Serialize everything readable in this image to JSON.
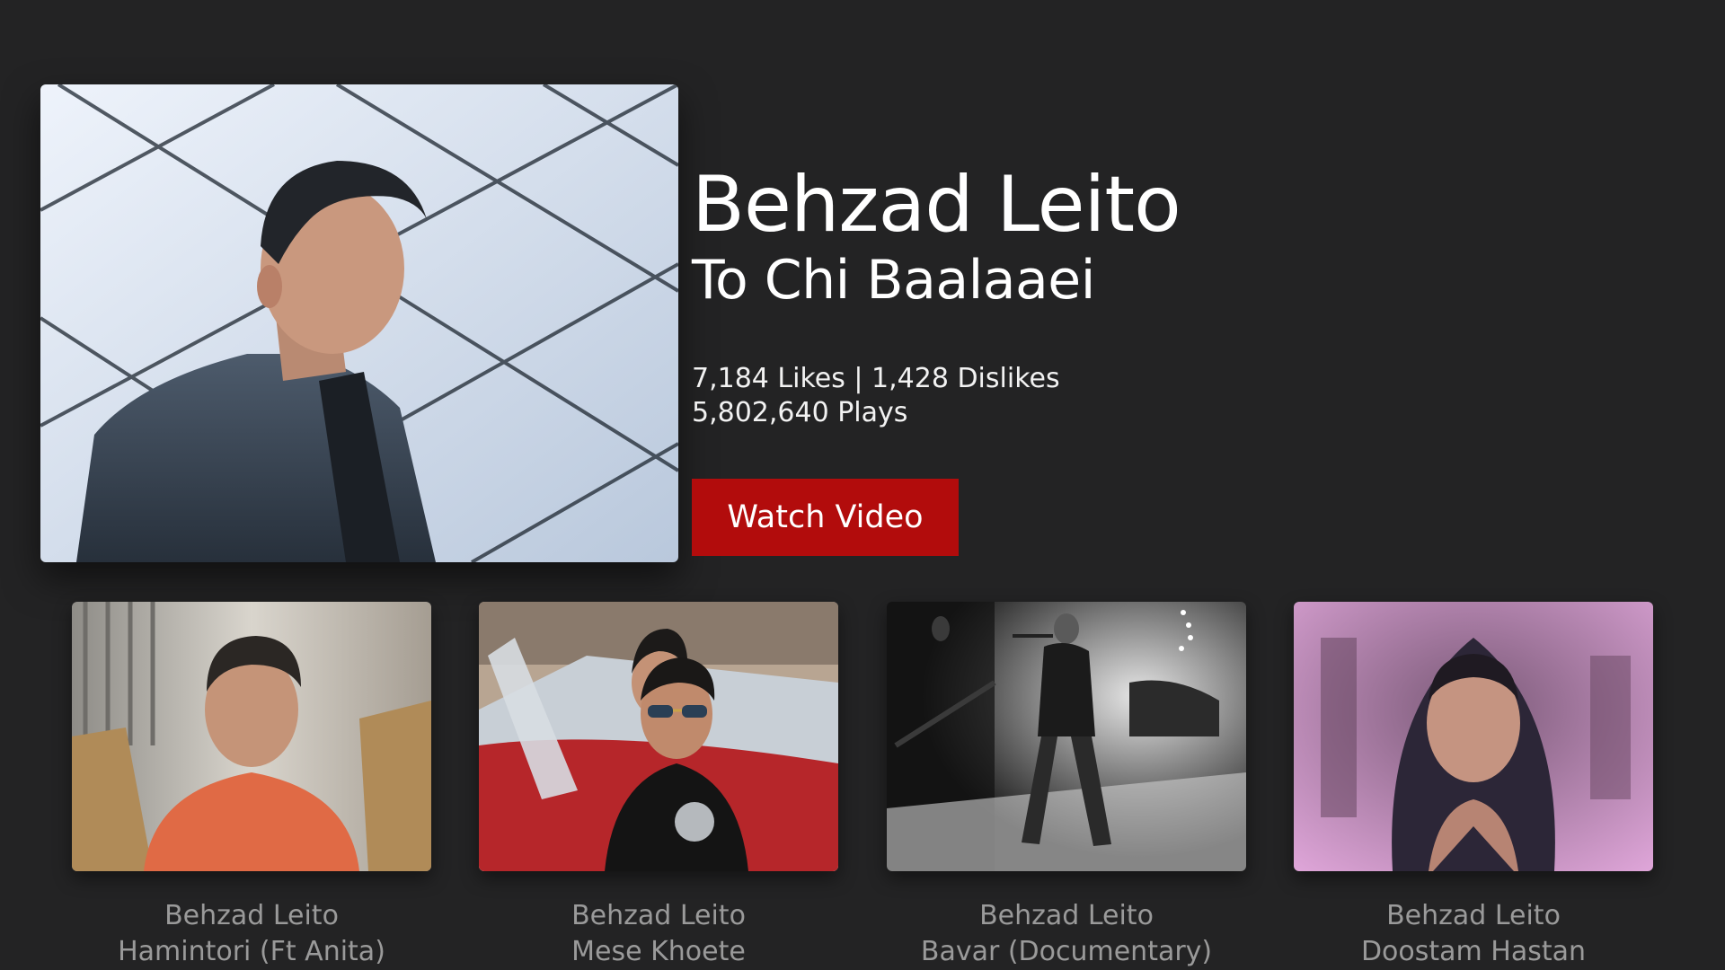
{
  "featured": {
    "artist": "Behzad Leito",
    "title": "To Chi Baalaaei",
    "stats_line1": "7,184 Likes | 1,428 Dislikes",
    "stats_line2": "5,802,640 Plays",
    "watch_label": "Watch Video",
    "accent_color": "#b20c0c",
    "image_icon": "artist-portrait"
  },
  "shelf": {
    "items": [
      {
        "artist": "Behzad Leito",
        "title": "Hamintori (Ft Anita)",
        "image_icon": "prison-scene"
      },
      {
        "artist": "Behzad Leito",
        "title": "Mese Khoete",
        "image_icon": "red-convertible-scene"
      },
      {
        "artist": "Behzad Leito",
        "title": "Bavar (Documentary)",
        "image_icon": "stage-performance-scene"
      },
      {
        "artist": "Behzad Leito",
        "title": "Doostam Hastan",
        "image_icon": "hooded-portrait"
      }
    ]
  }
}
